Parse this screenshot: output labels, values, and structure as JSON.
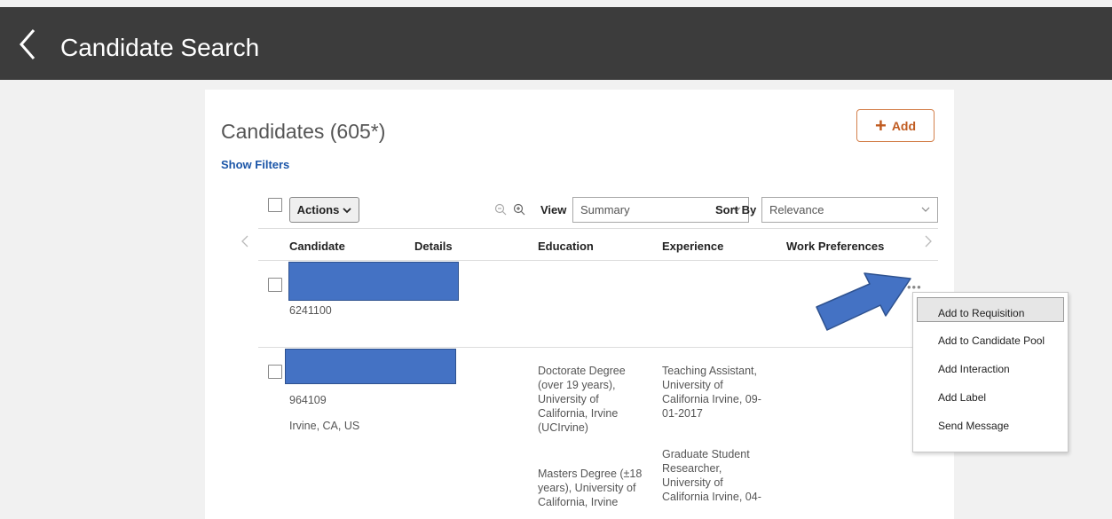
{
  "header": {
    "title": "Candidate Search"
  },
  "list": {
    "title": "Candidates (605*)",
    "show_filters": "Show Filters",
    "add_label": "Add",
    "actions_label": "Actions",
    "view_label": "View",
    "view_value": "Summary",
    "sort_label": "Sort By",
    "sort_value": "Relevance",
    "columns": [
      "Candidate",
      "Details",
      "Education",
      "Experience",
      "Work Preferences"
    ]
  },
  "rows": [
    {
      "id": "6241100",
      "location": "",
      "education": [],
      "experience": []
    },
    {
      "id": "964109",
      "location": "Irvine, CA, US",
      "education": [
        [
          "Doctorate Degree",
          "(over 19 years),",
          "University of",
          "California, Irvine",
          "(UCIrvine)"
        ],
        [
          "Masters Degree (±18",
          "years), University of",
          "California, Irvine"
        ]
      ],
      "experience": [
        [
          "Teaching Assistant,",
          "University of",
          "California Irvine, 09-",
          "01-2017"
        ],
        [
          "Graduate Student",
          "Researcher,",
          "University of",
          "California Irvine, 04-"
        ]
      ]
    }
  ],
  "context_menu": {
    "items": [
      "Add to Requisition",
      "Add to Candidate Pool",
      "Add Interaction",
      "Add Label",
      "Send Message"
    ]
  },
  "colors": {
    "topbar": "#3c3c3c",
    "link": "#1c56a8",
    "add_accent": "#c05b20",
    "redaction": "#4472c4",
    "arrow": "#4472c4"
  }
}
